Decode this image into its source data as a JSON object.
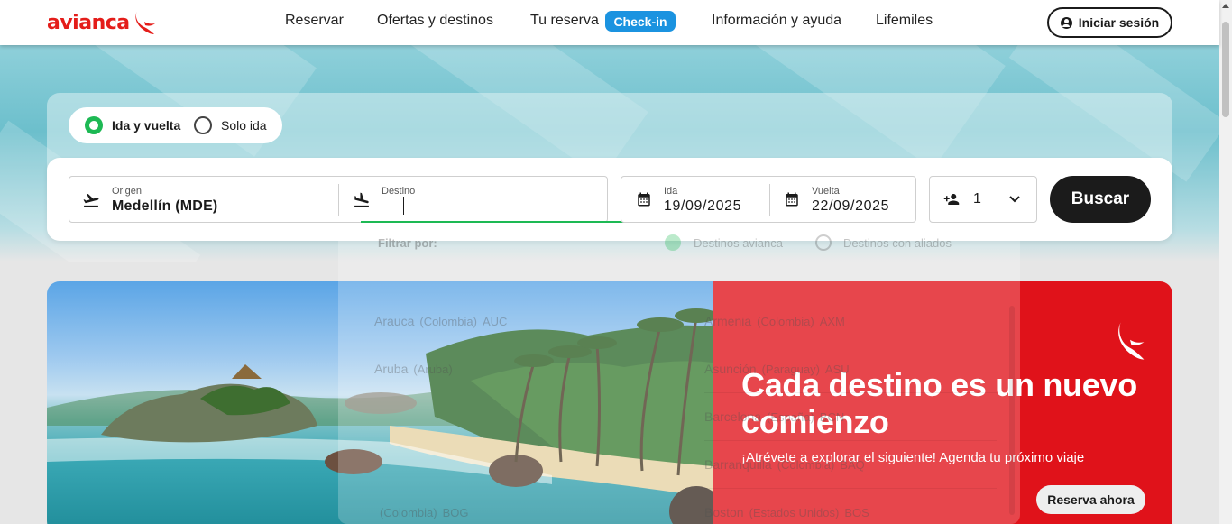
{
  "header": {
    "logo_text": "avianca",
    "nav": [
      "Reservar",
      "Ofertas y destinos",
      "Tu reserva",
      "Información y ayuda",
      "Lifemiles"
    ],
    "checkin_badge": "Check-in",
    "login_label": "Iniciar sesión"
  },
  "trip_type": {
    "options": [
      "Ida y vuelta",
      "Solo ida"
    ],
    "selected": "Ida y vuelta"
  },
  "search": {
    "origin_label": "Origen",
    "origin_value": "Medellín  (MDE)",
    "destination_label": "Destino",
    "destination_value": "",
    "depart_label": "Ida",
    "depart_value": "19/09/2025",
    "return_label": "Vuelta",
    "return_value": "22/09/2025",
    "passengers": "1",
    "search_button": "Buscar"
  },
  "dropdown": {
    "filter_label": "Filtrar por:",
    "filters": [
      "Destinos avianca",
      "Destinos con aliados"
    ],
    "selected_filter": "Destinos avianca",
    "left_items": [
      {
        "city": "Arauca",
        "country": "(Colombia)",
        "code": "AUC"
      },
      {
        "city": "Aruba",
        "country": "(Aruba)",
        "code": ""
      },
      {
        "city": "",
        "country": "",
        "code": ""
      },
      {
        "city": "",
        "country": "",
        "code": ""
      },
      {
        "city": "",
        "country": "(Colombia)",
        "code": "BOG"
      }
    ],
    "right_items": [
      {
        "city": "Armenia",
        "country": "(Colombia)",
        "code": "AXM"
      },
      {
        "city": "Asunción",
        "country": "(Paraguay)",
        "code": "ASU"
      },
      {
        "city": "Barcelona",
        "country": "(España)",
        "code": "BCN"
      },
      {
        "city": "Barranquilla",
        "country": "(Colombia)",
        "code": "BAQ"
      },
      {
        "city": "Boston",
        "country": "(Estados Unidos)",
        "code": "BOS"
      }
    ]
  },
  "banner": {
    "title": "Cada destino es un nuevo comienzo",
    "subtitle": "¡Atrévete a explorar el siguiente! Agenda tu próximo viaje",
    "cta": "Reserva ahora"
  },
  "colors": {
    "brand_red": "#e41d1a",
    "banner_red": "#e0121a",
    "checkin_blue": "#1b93e0",
    "accent_green": "#1db954",
    "dark": "#1b1b1b"
  }
}
